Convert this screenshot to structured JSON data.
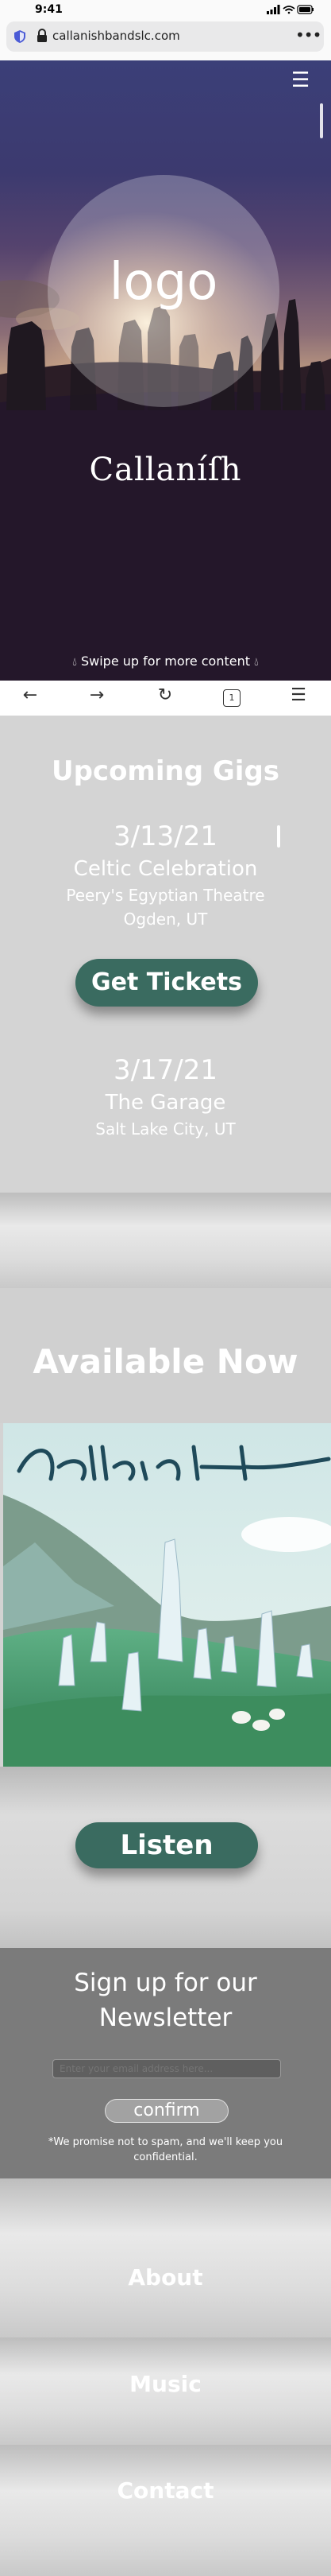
{
  "status": {
    "time": "9:41"
  },
  "browser": {
    "url": "callanishbandslc.com",
    "more": "•••",
    "toolbar": {
      "back": "←",
      "forward": "→",
      "reload": "↻",
      "tab_count": "1",
      "menu": "☰"
    }
  },
  "hero": {
    "logo": "logo",
    "band_name": "Callaníſh",
    "swipe_hint": "Swipe up for more content"
  },
  "gigs": {
    "title": "Upcoming Gigs",
    "items": [
      {
        "date": "3/13/21",
        "name": "Celtic Celebration",
        "venue": "Peery's Egyptian Theatre",
        "city": "Ogden, UT"
      },
      {
        "date": "3/17/21",
        "name": "The Garage",
        "venue": "",
        "city": "Salt Lake City, UT"
      }
    ],
    "tickets_button": "Get Tickets"
  },
  "available": {
    "title": "Available Now",
    "album_script": "Callanish",
    "listen_button": "Listen"
  },
  "newsletter": {
    "title_line1": "Sign up for our",
    "title_line2": "Newsletter",
    "email_placeholder": "Enter your email address here...",
    "confirm_button": "confirm",
    "note": "*We promise not to spam, and we'll keep you confidential."
  },
  "nav": {
    "about": "About",
    "music": "Music",
    "contact": "Contact"
  },
  "colors": {
    "button_green": "#3a6b60",
    "page_gray": "#d3d3d3",
    "newsletter_gray": "#7b7b7b"
  }
}
